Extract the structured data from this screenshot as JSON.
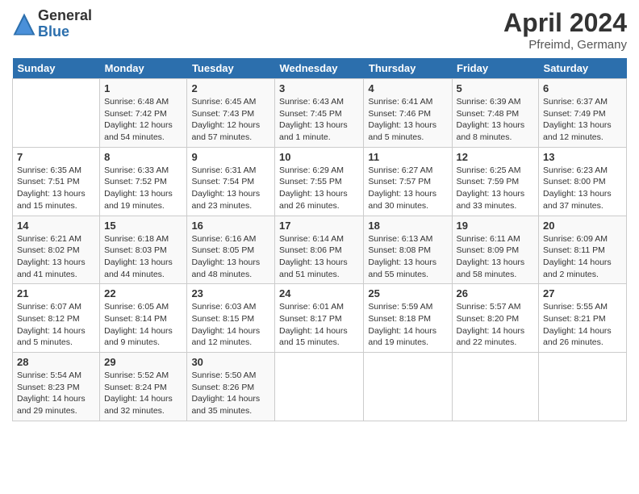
{
  "header": {
    "logo_general": "General",
    "logo_blue": "Blue",
    "month_title": "April 2024",
    "location": "Pfreimd, Germany"
  },
  "columns": [
    "Sunday",
    "Monday",
    "Tuesday",
    "Wednesday",
    "Thursday",
    "Friday",
    "Saturday"
  ],
  "weeks": [
    [
      {
        "num": "",
        "info": ""
      },
      {
        "num": "1",
        "info": "Sunrise: 6:48 AM\nSunset: 7:42 PM\nDaylight: 12 hours\nand 54 minutes."
      },
      {
        "num": "2",
        "info": "Sunrise: 6:45 AM\nSunset: 7:43 PM\nDaylight: 12 hours\nand 57 minutes."
      },
      {
        "num": "3",
        "info": "Sunrise: 6:43 AM\nSunset: 7:45 PM\nDaylight: 13 hours\nand 1 minute."
      },
      {
        "num": "4",
        "info": "Sunrise: 6:41 AM\nSunset: 7:46 PM\nDaylight: 13 hours\nand 5 minutes."
      },
      {
        "num": "5",
        "info": "Sunrise: 6:39 AM\nSunset: 7:48 PM\nDaylight: 13 hours\nand 8 minutes."
      },
      {
        "num": "6",
        "info": "Sunrise: 6:37 AM\nSunset: 7:49 PM\nDaylight: 13 hours\nand 12 minutes."
      }
    ],
    [
      {
        "num": "7",
        "info": "Sunrise: 6:35 AM\nSunset: 7:51 PM\nDaylight: 13 hours\nand 15 minutes."
      },
      {
        "num": "8",
        "info": "Sunrise: 6:33 AM\nSunset: 7:52 PM\nDaylight: 13 hours\nand 19 minutes."
      },
      {
        "num": "9",
        "info": "Sunrise: 6:31 AM\nSunset: 7:54 PM\nDaylight: 13 hours\nand 23 minutes."
      },
      {
        "num": "10",
        "info": "Sunrise: 6:29 AM\nSunset: 7:55 PM\nDaylight: 13 hours\nand 26 minutes."
      },
      {
        "num": "11",
        "info": "Sunrise: 6:27 AM\nSunset: 7:57 PM\nDaylight: 13 hours\nand 30 minutes."
      },
      {
        "num": "12",
        "info": "Sunrise: 6:25 AM\nSunset: 7:59 PM\nDaylight: 13 hours\nand 33 minutes."
      },
      {
        "num": "13",
        "info": "Sunrise: 6:23 AM\nSunset: 8:00 PM\nDaylight: 13 hours\nand 37 minutes."
      }
    ],
    [
      {
        "num": "14",
        "info": "Sunrise: 6:21 AM\nSunset: 8:02 PM\nDaylight: 13 hours\nand 41 minutes."
      },
      {
        "num": "15",
        "info": "Sunrise: 6:18 AM\nSunset: 8:03 PM\nDaylight: 13 hours\nand 44 minutes."
      },
      {
        "num": "16",
        "info": "Sunrise: 6:16 AM\nSunset: 8:05 PM\nDaylight: 13 hours\nand 48 minutes."
      },
      {
        "num": "17",
        "info": "Sunrise: 6:14 AM\nSunset: 8:06 PM\nDaylight: 13 hours\nand 51 minutes."
      },
      {
        "num": "18",
        "info": "Sunrise: 6:13 AM\nSunset: 8:08 PM\nDaylight: 13 hours\nand 55 minutes."
      },
      {
        "num": "19",
        "info": "Sunrise: 6:11 AM\nSunset: 8:09 PM\nDaylight: 13 hours\nand 58 minutes."
      },
      {
        "num": "20",
        "info": "Sunrise: 6:09 AM\nSunset: 8:11 PM\nDaylight: 14 hours\nand 2 minutes."
      }
    ],
    [
      {
        "num": "21",
        "info": "Sunrise: 6:07 AM\nSunset: 8:12 PM\nDaylight: 14 hours\nand 5 minutes."
      },
      {
        "num": "22",
        "info": "Sunrise: 6:05 AM\nSunset: 8:14 PM\nDaylight: 14 hours\nand 9 minutes."
      },
      {
        "num": "23",
        "info": "Sunrise: 6:03 AM\nSunset: 8:15 PM\nDaylight: 14 hours\nand 12 minutes."
      },
      {
        "num": "24",
        "info": "Sunrise: 6:01 AM\nSunset: 8:17 PM\nDaylight: 14 hours\nand 15 minutes."
      },
      {
        "num": "25",
        "info": "Sunrise: 5:59 AM\nSunset: 8:18 PM\nDaylight: 14 hours\nand 19 minutes."
      },
      {
        "num": "26",
        "info": "Sunrise: 5:57 AM\nSunset: 8:20 PM\nDaylight: 14 hours\nand 22 minutes."
      },
      {
        "num": "27",
        "info": "Sunrise: 5:55 AM\nSunset: 8:21 PM\nDaylight: 14 hours\nand 26 minutes."
      }
    ],
    [
      {
        "num": "28",
        "info": "Sunrise: 5:54 AM\nSunset: 8:23 PM\nDaylight: 14 hours\nand 29 minutes."
      },
      {
        "num": "29",
        "info": "Sunrise: 5:52 AM\nSunset: 8:24 PM\nDaylight: 14 hours\nand 32 minutes."
      },
      {
        "num": "30",
        "info": "Sunrise: 5:50 AM\nSunset: 8:26 PM\nDaylight: 14 hours\nand 35 minutes."
      },
      {
        "num": "",
        "info": ""
      },
      {
        "num": "",
        "info": ""
      },
      {
        "num": "",
        "info": ""
      },
      {
        "num": "",
        "info": ""
      }
    ]
  ]
}
